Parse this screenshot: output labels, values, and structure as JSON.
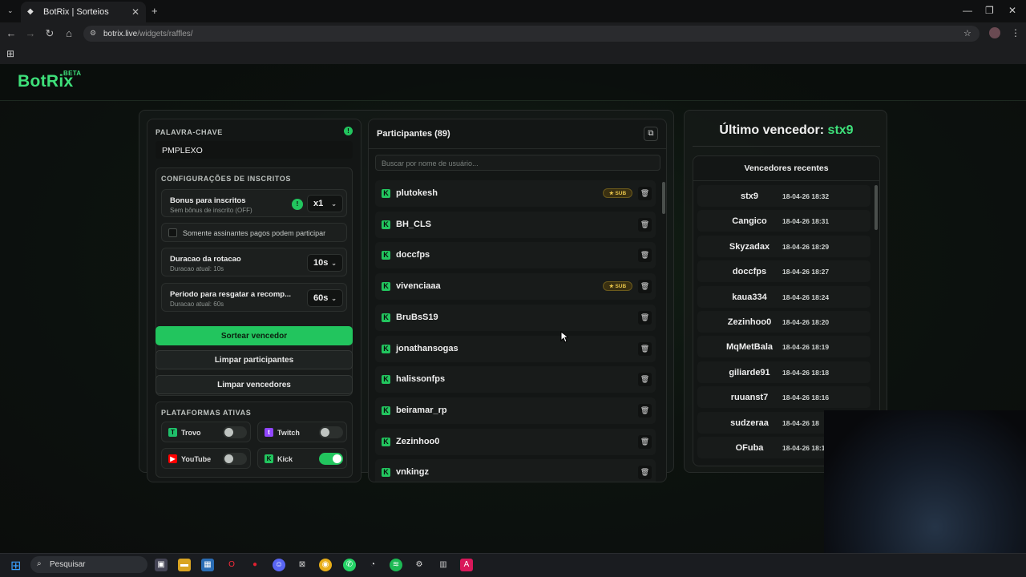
{
  "browser": {
    "tab_title": "BotRix | Sorteios",
    "url_domain": "botrix.live",
    "url_path": "/widgets/raffles/"
  },
  "app": {
    "logo": "BotRix",
    "logo_badge": "BETA"
  },
  "settings": {
    "keyword_label": "PALAVRA-CHAVE",
    "keyword_value": "PMPLEXO",
    "subs_section_label": "CONFIGURAÇÕES DE INSCRITOS",
    "bonus_title": "Bonus para inscritos",
    "bonus_sub": "Sem bônus de inscrito (OFF)",
    "bonus_value": "x1",
    "only_paid_label": "Somente assinantes pagos podem participar",
    "rotation_title": "Duracao da rotacao",
    "rotation_sub": "Duracao atual: 10s",
    "rotation_value": "10s",
    "redeem_title": "Periodo para resgatar a recomp...",
    "redeem_sub": "Duracao atual: 60s",
    "redeem_value": "60s",
    "draw_button": "Sortear vencedor",
    "clear_participants_button": "Limpar participantes",
    "clear_winners_button": "Limpar vencedores",
    "platforms_label": "PLATAFORMAS ATIVAS",
    "platforms": [
      {
        "name": "Trovo",
        "enabled": false,
        "color": "#1fbf6a"
      },
      {
        "name": "Twitch",
        "enabled": false,
        "color": "#9146ff"
      },
      {
        "name": "YouTube",
        "enabled": false,
        "color": "#ff0000"
      },
      {
        "name": "Kick",
        "enabled": true,
        "color": "#22c55e"
      }
    ]
  },
  "participants": {
    "title": "Participantes (89)",
    "search_placeholder": "Buscar por nome de usuário...",
    "sub_badge": "SUB",
    "list": [
      {
        "name": "plutokesh",
        "sub": true
      },
      {
        "name": "BH_CLS",
        "sub": false
      },
      {
        "name": "doccfps",
        "sub": false
      },
      {
        "name": "vivenciaaa",
        "sub": true
      },
      {
        "name": "BruBsS19",
        "sub": false
      },
      {
        "name": "jonathansogas",
        "sub": false
      },
      {
        "name": "halissonfps",
        "sub": false
      },
      {
        "name": "beiramar_rp",
        "sub": false
      },
      {
        "name": "Zezinhoo0",
        "sub": false
      },
      {
        "name": "vnkingz",
        "sub": false
      }
    ]
  },
  "winners": {
    "last_label": "Último vencedor:",
    "last_name": "stx9",
    "recent_title": "Vencedores recentes",
    "list": [
      {
        "name": "stx9",
        "date": "18-04-26 18:32"
      },
      {
        "name": "Cangico",
        "date": "18-04-26 18:31"
      },
      {
        "name": "Skyzadax",
        "date": "18-04-26 18:29"
      },
      {
        "name": "doccfps",
        "date": "18-04-26 18:27"
      },
      {
        "name": "kaua334",
        "date": "18-04-26 18:24"
      },
      {
        "name": "Zezinhoo0",
        "date": "18-04-26 18:20"
      },
      {
        "name": "MqMetBala",
        "date": "18-04-26 18:19"
      },
      {
        "name": "giliarde91",
        "date": "18-04-26 18:18"
      },
      {
        "name": "ruuanst7",
        "date": "18-04-26 18:16"
      },
      {
        "name": "sudzeraa",
        "date": "18-04-26 18"
      },
      {
        "name": "OFuba",
        "date": "18-04-26 18:1"
      }
    ]
  },
  "taskbar": {
    "search_label": "Pesquisar"
  }
}
